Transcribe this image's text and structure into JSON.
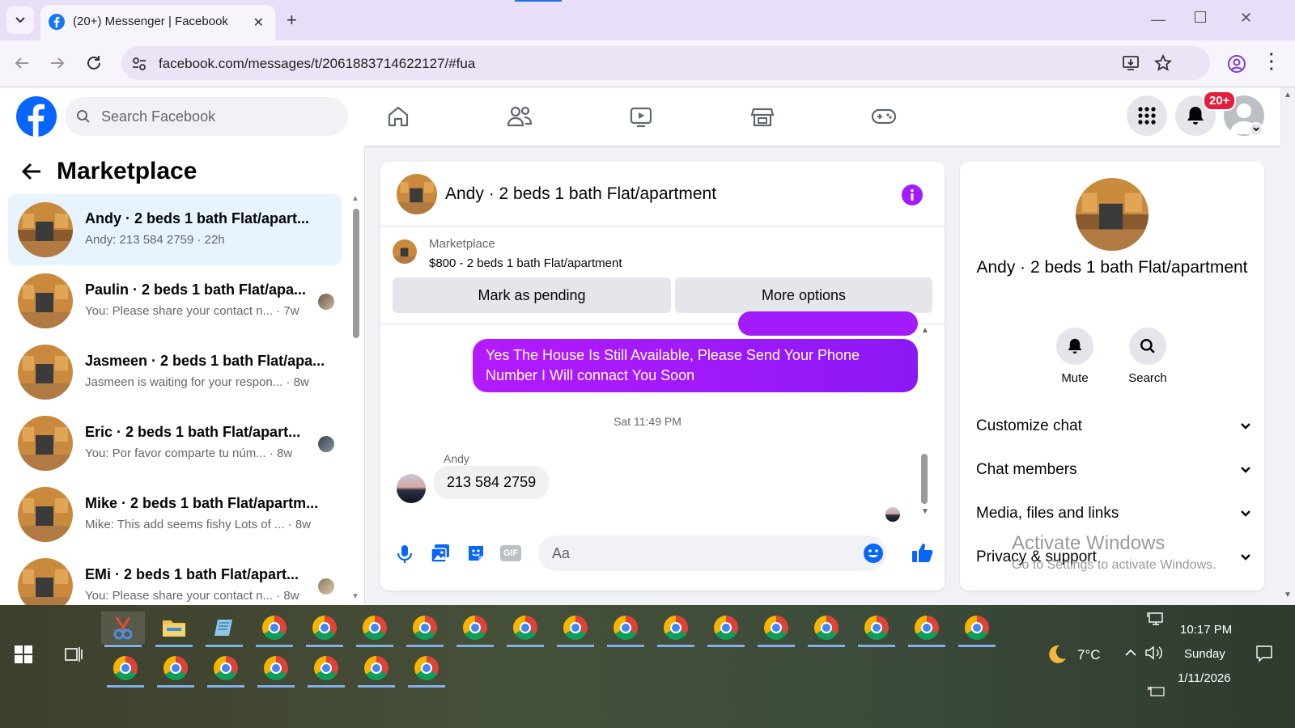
{
  "browser": {
    "tab_title": "(20+) Messenger | Facebook",
    "url": "facebook.com/messages/t/2061883714622127/#fua"
  },
  "fb_header": {
    "search_placeholder": "Search Facebook",
    "notification_badge": "20+"
  },
  "left_panel": {
    "title": "Marketplace",
    "conversations": [
      {
        "name": "Andy · 2 beds 1 bath Flat/apart...",
        "snippet": "Andy: 213 584 2759 · 22h"
      },
      {
        "name": "Paulin · 2 beds 1 bath Flat/apa...",
        "snippet": "You: Please share your contact n... · 7w"
      },
      {
        "name": "Jasmeen · 2 beds 1 bath Flat/apa...",
        "snippet": "Jasmeen is waiting for your respon... · 8w"
      },
      {
        "name": "Eric · 2 beds 1 bath Flat/apart...",
        "snippet": "You: Por favor comparte tu núm... · 8w"
      },
      {
        "name": "Mike · 2 beds 1 bath Flat/apartm...",
        "snippet": "Mike: This add seems fishy Lots of ... · 8w"
      },
      {
        "name": "EMi · 2 beds 1 bath Flat/apart...",
        "snippet": "You: Please share your contact n... · 8w"
      }
    ]
  },
  "chat": {
    "title": "Andy · 2 beds 1 bath Flat/apartment",
    "marketplace_label": "Marketplace",
    "listing": "$800 - 2 beds 1 bath Flat/apartment",
    "mark_pending": "Mark as pending",
    "more_options": "More options",
    "outgoing_message": "Yes The House Is Still Available, Please Send Your Phone Number I Will connact You Soon",
    "timestamp": "Sat 11:49 PM",
    "sender": "Andy",
    "incoming_message": "213 584 2759",
    "composer_placeholder": "Aa",
    "accent_color": "#a21bfb"
  },
  "info_panel": {
    "name": "Andy · 2 beds 1 bath Flat/apartment",
    "mute": "Mute",
    "search": "Search",
    "rows": [
      "Customize chat",
      "Chat members",
      "Media, files and links",
      "Privacy & support"
    ]
  },
  "watermark": {
    "title": "Activate Windows",
    "subtitle": "Go to Settings to activate Windows."
  },
  "taskbar": {
    "weather": "7°C",
    "time": "10:17 PM",
    "day": "Sunday",
    "date": "1/11/2026"
  }
}
